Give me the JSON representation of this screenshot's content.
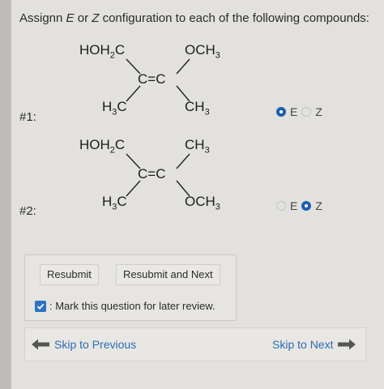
{
  "question": "Assignn E or Z configuration to each of the following compounds:",
  "items": [
    {
      "label": "#1:",
      "top_left": "HOH2C",
      "top_right": "OCH3",
      "bottom_left": "H3C",
      "bottom_right": "CH3",
      "bond_left": "C",
      "bond": "=",
      "bond_right": "C",
      "options": [
        "E",
        "Z"
      ],
      "selected": "E"
    },
    {
      "label": "#2:",
      "top_left": "HOH2C",
      "top_right": "CH3",
      "bottom_left": "H3C",
      "bottom_right": "OCH3",
      "bond_left": "C",
      "bond": "=",
      "bond_right": "C",
      "options": [
        "E",
        "Z"
      ],
      "selected": "Z"
    }
  ],
  "buttons": {
    "resubmit": "Resubmit",
    "resubmit_next": "Resubmit and Next"
  },
  "review_label": ": Mark this question for later review.",
  "nav": {
    "previous": "Skip to Previous",
    "next": "Skip to Next"
  },
  "colors": {
    "accent": "#1f5fb0",
    "link": "#2d6bb3"
  }
}
